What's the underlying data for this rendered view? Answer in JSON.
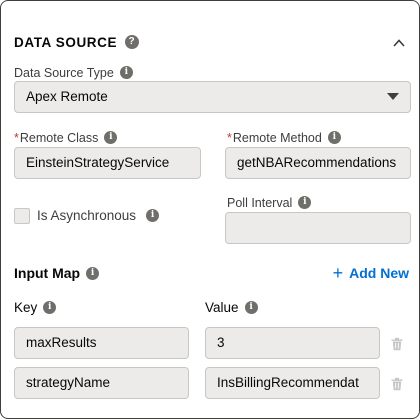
{
  "section": {
    "title": "DATA SOURCE",
    "help_glyph": "?"
  },
  "data_source_type": {
    "label": "Data Source Type",
    "value": "Apex Remote"
  },
  "remote_class": {
    "required_mark": "*",
    "label": "Remote Class",
    "value": "EinsteinStrategyService"
  },
  "remote_method": {
    "required_mark": "*",
    "label": "Remote Method",
    "value": "getNBARecommendations"
  },
  "is_asynchronous": {
    "label": "Is Asynchronous",
    "checked": false
  },
  "poll_interval": {
    "label": "Poll Interval",
    "value": ""
  },
  "input_map": {
    "title": "Input Map",
    "add_new_label": "Add New",
    "key_header": "Key",
    "value_header": "Value",
    "rows": [
      {
        "key": "maxResults",
        "value": "3"
      },
      {
        "key": "strategyName",
        "value": "InsBillingRecommendat"
      }
    ]
  },
  "icons": {
    "help": "help-icon",
    "info": "info-icon",
    "collapse": "chevron-up-icon",
    "dropdown": "down-arrow-icon",
    "add": "plus-icon",
    "delete": "trash-icon"
  },
  "colors": {
    "link": "#0070d2",
    "required": "#c23934",
    "field_bg": "#ecebea"
  }
}
